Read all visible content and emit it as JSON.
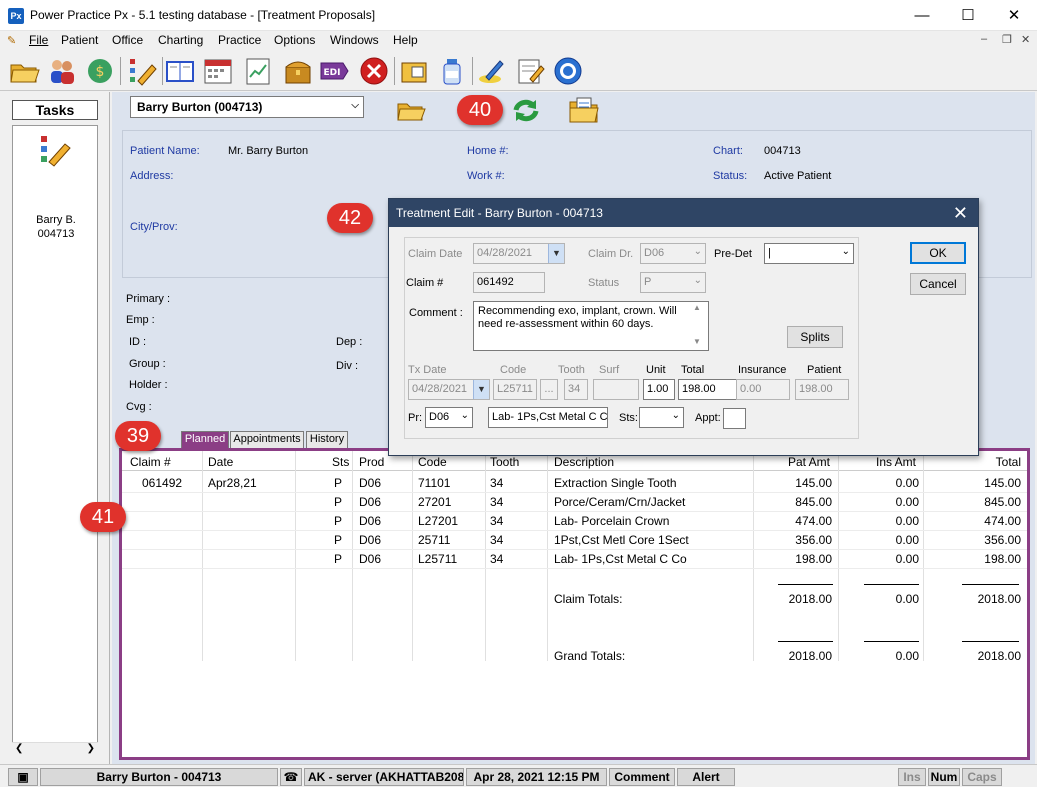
{
  "window": {
    "app_icon": "Px",
    "title": "Power Practice Px - 5.1 testing database - [Treatment Proposals]"
  },
  "menu": {
    "items": [
      "File",
      "Patient",
      "Office",
      "Charting",
      "Practice",
      "Options",
      "Windows",
      "Help"
    ]
  },
  "toolbar": {
    "icons": [
      "open-folder-icon",
      "users-icon",
      "exchange-icon",
      "edit-pencil-icon",
      "book-icon",
      "calendar-icon",
      "report-icon",
      "treasure-chest-icon",
      "edi-icon",
      "stop-icon",
      "address-card-icon",
      "bottle-icon",
      "pen-sign-icon",
      "notepad-icon",
      "help-circle-icon"
    ],
    "edi_label": "EDI"
  },
  "tasks": {
    "header": "Tasks",
    "patient_line1": "Barry B.",
    "patient_line2": "004713"
  },
  "patient": {
    "selector": "Barry Burton (004713)",
    "labels": {
      "name": "Patient Name:",
      "address": "Address:",
      "city": "City/Prov:",
      "home": "Home #:",
      "work": "Work #:",
      "chart": "Chart:",
      "status": "Status:"
    },
    "name": "Mr. Barry Burton",
    "chart": "004713",
    "status": "Active Patient"
  },
  "insurance": {
    "labels": {
      "primary": "Primary :",
      "emp": "Emp :",
      "id": "ID :",
      "dep": "Dep :",
      "group": "Group :",
      "div": "Div :",
      "holder": "Holder :",
      "cvg": "Cvg :"
    }
  },
  "tabs": [
    "Planned",
    "Appointments",
    "History"
  ],
  "grid": {
    "columns": [
      "Claim #",
      "Date",
      "Sts",
      "Prod",
      "Code",
      "Tooth",
      "Description",
      "Pat Amt",
      "Ins Amt",
      "Total"
    ],
    "rows": [
      {
        "claim": "061492",
        "date": "Apr28,21",
        "sts": "P",
        "prod": "D06",
        "code": "71101",
        "tooth": "34",
        "desc": "Extraction Single Tooth",
        "pat": "145.00",
        "ins": "0.00",
        "total": "145.00"
      },
      {
        "claim": "",
        "date": "",
        "sts": "P",
        "prod": "D06",
        "code": "27201",
        "tooth": "34",
        "desc": "Porce/Ceram/Crn/Jacket",
        "pat": "845.00",
        "ins": "0.00",
        "total": "845.00"
      },
      {
        "claim": "",
        "date": "",
        "sts": "P",
        "prod": "D06",
        "code": "L27201",
        "tooth": "34",
        "desc": "Lab- Porcelain Crown",
        "pat": "474.00",
        "ins": "0.00",
        "total": "474.00"
      },
      {
        "claim": "",
        "date": "",
        "sts": "P",
        "prod": "D06",
        "code": "25711",
        "tooth": "34",
        "desc": "1Pst,Cst Metl Core 1Sect",
        "pat": "356.00",
        "ins": "0.00",
        "total": "356.00"
      },
      {
        "claim": "",
        "date": "",
        "sts": "P",
        "prod": "D06",
        "code": "L25711",
        "tooth": "34",
        "desc": "Lab- 1Ps,Cst Metal C Co",
        "pat": "198.00",
        "ins": "0.00",
        "total": "198.00"
      }
    ],
    "claim_totals": {
      "label": "Claim Totals:",
      "pat": "2018.00",
      "ins": "0.00",
      "total": "2018.00"
    },
    "grand_totals": {
      "label": "Grand Totals:",
      "pat": "2018.00",
      "ins": "0.00",
      "total": "2018.00"
    }
  },
  "dialog": {
    "title": "Treatment Edit - Barry Burton - 004713",
    "claim_date_label": "Claim Date",
    "claim_date": "04/28/2021",
    "claim_dr_label": "Claim Dr.",
    "claim_dr": "D06",
    "predet_label": "Pre-Det",
    "predet_value": "|",
    "claim_no_label": "Claim #",
    "claim_no": "061492",
    "status_label": "Status",
    "status": "P",
    "comment_label": "Comment :",
    "comment": "Recommending exo, implant, crown. Will need re-assessment within 60 days.",
    "splits_label": "Splits",
    "ok_label": "OK",
    "cancel_label": "Cancel",
    "tx_date_label": "Tx Date",
    "code_label": "Code",
    "tooth_label": "Tooth",
    "surf_label": "Surf",
    "unit_label": "Unit",
    "total_label": "Total",
    "insurance_label": "Insurance",
    "patient_label": "Patient",
    "tx_date": "04/28/2021",
    "code": "L25711",
    "code_btn": "...",
    "tooth": "34",
    "surf": "",
    "unit": "1.00",
    "total": "198.00",
    "insurance": "0.00",
    "patient": "198.00",
    "pr_label": "Pr:",
    "pr": "D06",
    "desc": "Lab- 1Ps,Cst Metal C Co",
    "sts_label": "Sts:",
    "sts": "",
    "appt_label": "Appt:",
    "appt": ""
  },
  "statusbar": {
    "patient": "Barry Burton - 004713",
    "user": "AK - server (AKHATTAB208",
    "datetime": "Apr 28, 2021 12:15 PM",
    "comment": "Comment",
    "alert": "Alert",
    "ins": "Ins",
    "num": "Num",
    "caps": "Caps"
  },
  "callouts": [
    "39",
    "40",
    "41",
    "42"
  ],
  "colors": {
    "title_bar": "#2f4565",
    "accent_tab": "#8b3e85",
    "callout": "#e0322c",
    "label_blue": "#1f3aa3"
  }
}
